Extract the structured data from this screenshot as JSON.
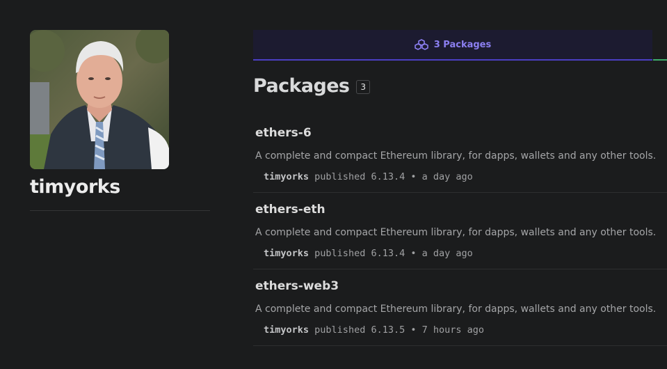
{
  "profile": {
    "username": "timyorks"
  },
  "tab": {
    "label": "3 Packages",
    "icon": "packages-icon"
  },
  "packages_section": {
    "title": "Packages",
    "count": "3"
  },
  "packages": [
    {
      "name": "ethers-6",
      "description": "A complete and compact Ethereum library, for dapps, wallets and any other tools.",
      "author": "timyorks",
      "published_text": "published 6.13.4 • a day ago"
    },
    {
      "name": "ethers-eth",
      "description": "A complete and compact Ethereum library, for dapps, wallets and any other tools.",
      "author": "timyorks",
      "published_text": "published 6.13.4 • a day ago"
    },
    {
      "name": "ethers-web3",
      "description": "A complete and compact Ethereum library, for dapps, wallets and any other tools.",
      "author": "timyorks",
      "published_text": "published 6.13.5 • 7 hours ago"
    }
  ],
  "colors": {
    "background": "#1b1c1d",
    "tab_background": "#1c1b30",
    "tab_accent": "#8b7ff0",
    "tab_underline": "#4b3fc4",
    "green_accent": "#3fae6b"
  }
}
